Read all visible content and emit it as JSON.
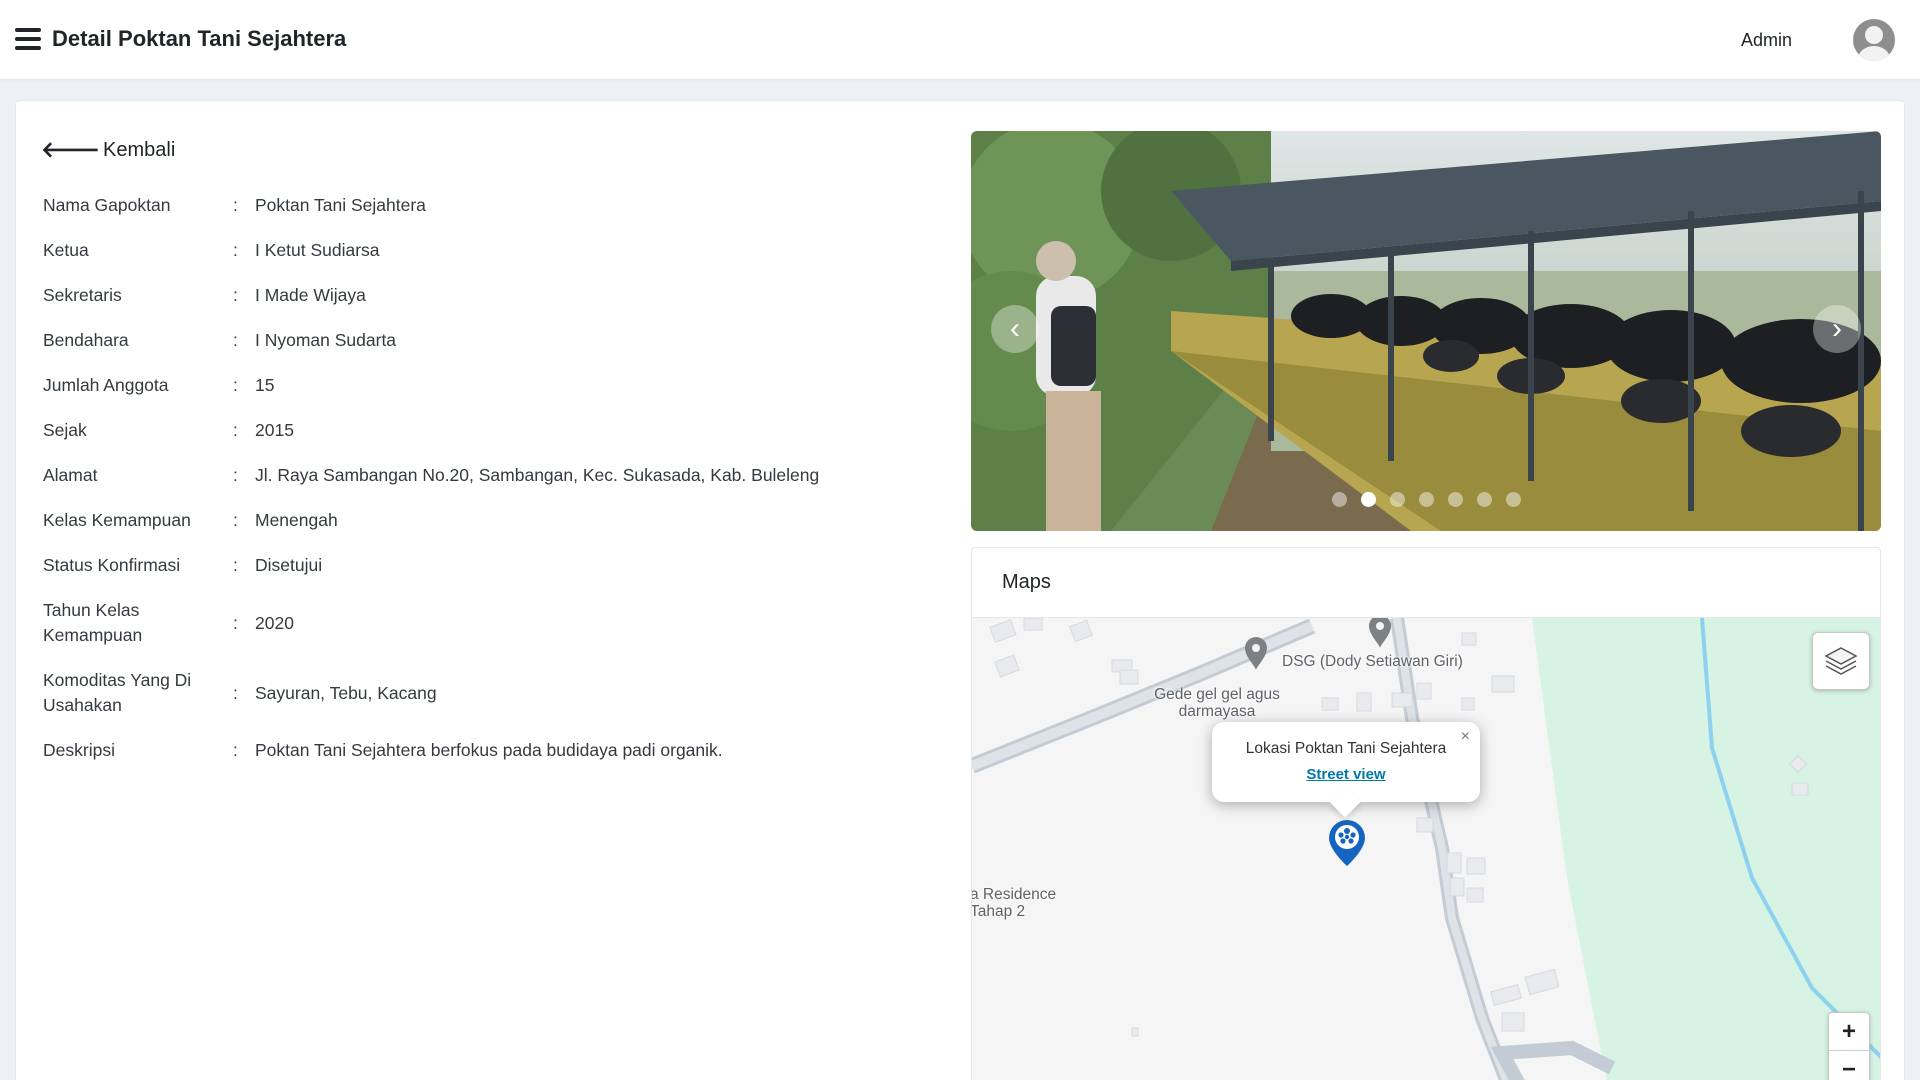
{
  "header": {
    "title": "Detail Poktan Tani Sejahtera",
    "user": "Admin"
  },
  "back": {
    "label": "Kembali"
  },
  "details": [
    {
      "label": "Nama Gapoktan",
      "value": "Poktan Tani Sejahtera"
    },
    {
      "label": "Ketua",
      "value": "I Ketut Sudiarsa"
    },
    {
      "label": "Sekretaris",
      "value": "I Made Wijaya"
    },
    {
      "label": "Bendahara",
      "value": "I Nyoman Sudarta"
    },
    {
      "label": "Jumlah Anggota",
      "value": "15"
    },
    {
      "label": "Sejak",
      "value": "2015"
    },
    {
      "label": "Alamat",
      "value": "Jl. Raya Sambangan No.20, Sambangan, Kec. Sukasada, Kab. Buleleng"
    },
    {
      "label": "Kelas Kemampuan",
      "value": "Menengah"
    },
    {
      "label": "Status Konfirmasi",
      "value": "Disetujui"
    },
    {
      "label": "Tahun Kelas Kemampuan",
      "value": "2020"
    },
    {
      "label": "Komoditas Yang Di Usahakan",
      "value": "Sayuran, Tebu, Kacang"
    },
    {
      "label": "Deskripsi",
      "value": "Poktan Tani Sejahtera berfokus pada budidaya padi organik."
    }
  ],
  "carousel": {
    "slide_count": 7,
    "active_slide": 2,
    "prev_glyph": "‹",
    "next_glyph": "›"
  },
  "maps": {
    "title": "Maps",
    "labels": {
      "dsg": "DSG (Dody Setiawan Giri)",
      "gede": "Gede gel gel agus darmayasa",
      "residence": "a Residence Tahap 2"
    },
    "popup": {
      "title": "Lokasi Poktan Tani Sejahtera",
      "link": "Street view",
      "close": "×"
    },
    "zoom_in": "+",
    "zoom_out": "−"
  },
  "colors": {
    "map_water": "#8ed0f0",
    "map_park": "#d7f3e3",
    "map_road": "#c3cbd4",
    "marker": "#1565c0",
    "link": "#0078a8"
  }
}
